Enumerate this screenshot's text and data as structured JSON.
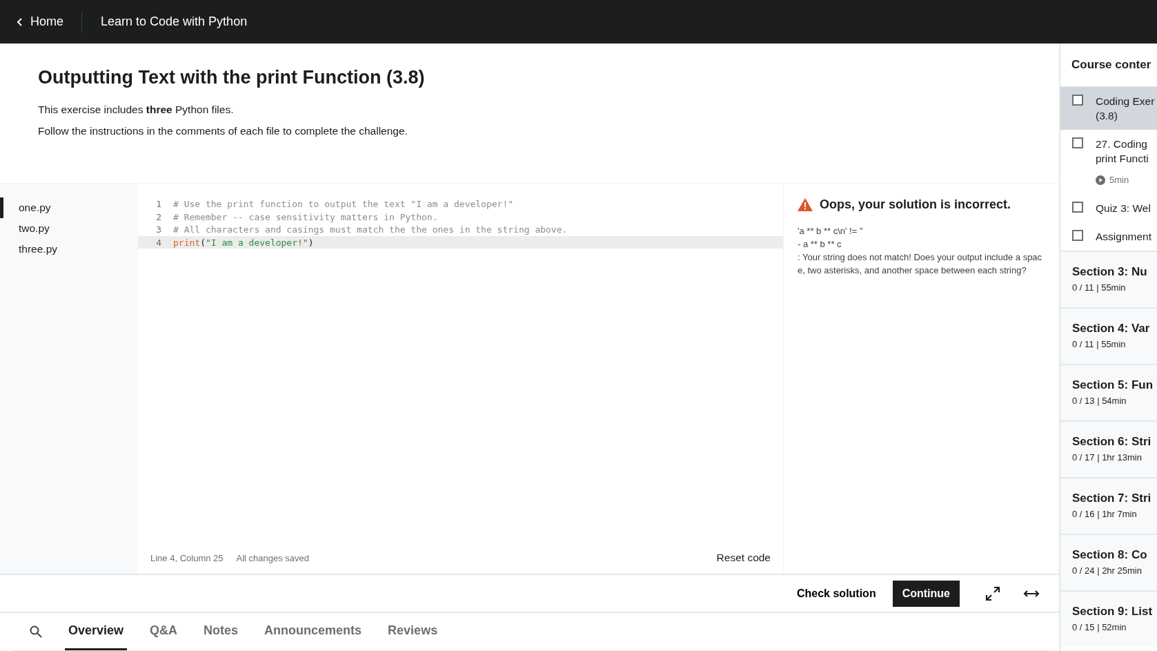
{
  "top_bar": {
    "back_label": "Home",
    "course_title": "Learn to Code with Python"
  },
  "exercise": {
    "title": "Outputting Text with the print Function (3.8)",
    "paragraphs": [
      "This exercise includes **three** Python files.",
      "Follow the instructions in the comments of each file to complete the challenge."
    ]
  },
  "files": [
    {
      "name": "one.py",
      "selected": true
    },
    {
      "name": "two.py",
      "selected": false
    },
    {
      "name": "three.py",
      "selected": false
    }
  ],
  "code_lines": [
    {
      "number": "1",
      "current": false,
      "tokens": [
        {
          "kind": "comment",
          "text": "# Use the print function to output the text \"I am a developer!\""
        }
      ]
    },
    {
      "number": "2",
      "current": false,
      "tokens": [
        {
          "kind": "comment",
          "text": "# Remember -- case sensitivity matters in Python."
        }
      ]
    },
    {
      "number": "3",
      "current": false,
      "tokens": [
        {
          "kind": "comment",
          "text": "# All characters and casings must match the the ones in the string above."
        }
      ]
    },
    {
      "number": "4",
      "current": true,
      "tokens": [
        {
          "kind": "builtin",
          "text": "print"
        },
        {
          "kind": "plain",
          "text": "("
        },
        {
          "kind": "string",
          "text": "\"I am a developer!\""
        },
        {
          "kind": "plain",
          "text": ")"
        }
      ]
    }
  ],
  "status": {
    "position": "Line 4, Column 25",
    "save_state": "All changes saved",
    "reset_label": "Reset code"
  },
  "result": {
    "title": "Oops, your solution is incorrect.",
    "lines": [
      "'a ** b ** c\\n' != ''",
      "- a ** b ** c",
      " : Your string does not match! Does your output include a space, two asterisks, and another space between each string?"
    ]
  },
  "actions": {
    "check_label": "Check solution",
    "continue_label": "Continue"
  },
  "tabs": [
    {
      "label": "Overview",
      "selected": true
    },
    {
      "label": "Q&A",
      "selected": false
    },
    {
      "label": "Notes",
      "selected": false
    },
    {
      "label": "Announcements",
      "selected": false
    },
    {
      "label": "Reviews",
      "selected": false
    }
  ],
  "sidebar": {
    "title": "Course conter",
    "items": [
      {
        "lines": [
          "Coding Exer",
          "(3.8)"
        ],
        "checked": false,
        "selected": true
      },
      {
        "lines": [
          "27. Coding",
          "print Functi"
        ],
        "duration": "5min",
        "checked": false,
        "selected": false
      },
      {
        "lines": [
          "Quiz 3: Wel"
        ],
        "checked": false,
        "selected": false
      },
      {
        "lines": [
          "Assignment"
        ],
        "checked": false,
        "selected": false
      }
    ],
    "sections": [
      {
        "title": "Section 3: Nu",
        "meta": "0 / 11 | 55min"
      },
      {
        "title": "Section 4: Var",
        "meta": "0 / 11 | 55min"
      },
      {
        "title": "Section 5: Fun",
        "meta": "0 / 13 | 54min"
      },
      {
        "title": "Section 6: Stri",
        "meta": "0 / 17 | 1hr 13min"
      },
      {
        "title": "Section 7: Stri",
        "meta": "0 / 16 | 1hr 7min"
      },
      {
        "title": "Section 8: Co",
        "meta": "0 / 24 | 2hr 25min"
      },
      {
        "title": "Section 9: List",
        "meta": "0 / 15 | 52min"
      }
    ]
  }
}
